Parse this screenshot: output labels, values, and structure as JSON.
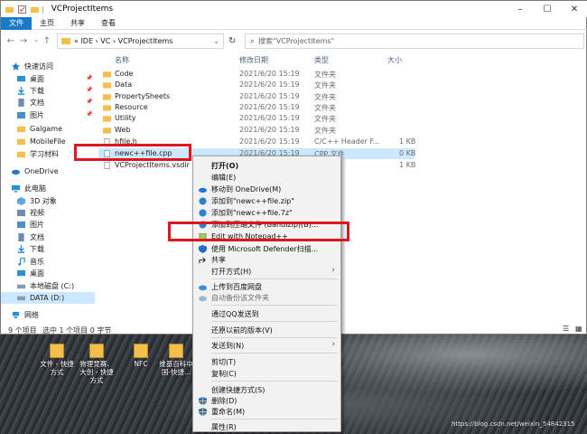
{
  "window": {
    "title": "VCProjectItems",
    "minimize": "–",
    "maximize": "☐",
    "close": "✕"
  },
  "ribbon": {
    "tabs": [
      "文件",
      "主页",
      "共享",
      "查看"
    ]
  },
  "address": {
    "crumbs": "«  IDE  ›  VC  ›  VCProjectItems",
    "search_placeholder": "搜索\"VCProjectItems\""
  },
  "nav": {
    "items": [
      {
        "label": "快速访问",
        "icon": "star-icon",
        "color": "#1c7ad1"
      },
      {
        "label": "桌面",
        "icon": "desktop-icon",
        "color": "#2d8fd6"
      },
      {
        "label": "下载",
        "icon": "download-icon",
        "color": "#2d8fd6"
      },
      {
        "label": "文档",
        "icon": "document-icon",
        "color": "#6f8bb0"
      },
      {
        "label": "图片",
        "icon": "picture-icon",
        "color": "#4a90c8"
      },
      {
        "label": "Galgame",
        "icon": "folder-icon",
        "color": "#f4c04d"
      },
      {
        "label": "MobileFile",
        "icon": "folder-icon",
        "color": "#f4c04d"
      },
      {
        "label": "学习材料",
        "icon": "folder-icon",
        "color": "#f4c04d"
      },
      {
        "label": "OneDrive",
        "icon": "cloud-icon",
        "color": "#1c7ad1"
      },
      {
        "label": "此电脑",
        "icon": "computer-icon",
        "color": "#2d8fd6"
      },
      {
        "label": "3D 对象",
        "icon": "cube-icon",
        "color": "#5aa6e0"
      },
      {
        "label": "视频",
        "icon": "video-icon",
        "color": "#6f8bb0"
      },
      {
        "label": "图片",
        "icon": "picture-icon",
        "color": "#4a90c8"
      },
      {
        "label": "文档",
        "icon": "document-icon",
        "color": "#6f8bb0"
      },
      {
        "label": "下载",
        "icon": "download-icon",
        "color": "#2d8fd6"
      },
      {
        "label": "音乐",
        "icon": "music-icon",
        "color": "#2d8fd6"
      },
      {
        "label": "桌面",
        "icon": "desktop-icon",
        "color": "#2d8fd6"
      },
      {
        "label": "本地磁盘 (C:)",
        "icon": "drive-icon",
        "color": "#8a9bb0"
      },
      {
        "label": "DATA (D:)",
        "icon": "drive-icon",
        "color": "#8a9bb0"
      },
      {
        "label": "网络",
        "icon": "network-icon",
        "color": "#2d8fd6"
      }
    ]
  },
  "columns": {
    "name": "名称",
    "date": "修改日期",
    "type": "类型",
    "size": "大小"
  },
  "files": [
    {
      "name": "Code",
      "date": "2021/6/20 15:19",
      "type": "文件夹",
      "size": "",
      "icon": "folder-icon"
    },
    {
      "name": "Data",
      "date": "2021/6/20 15:19",
      "type": "文件夹",
      "size": "",
      "icon": "folder-icon"
    },
    {
      "name": "PropertySheets",
      "date": "2021/6/20 15:19",
      "type": "文件夹",
      "size": "",
      "icon": "folder-icon"
    },
    {
      "name": "Resource",
      "date": "2021/6/20 15:19",
      "type": "文件夹",
      "size": "",
      "icon": "folder-icon"
    },
    {
      "name": "Utility",
      "date": "2021/6/20 15:19",
      "type": "文件夹",
      "size": "",
      "icon": "folder-icon"
    },
    {
      "name": "Web",
      "date": "2021/6/20 15:19",
      "type": "文件夹",
      "size": "",
      "icon": "folder-icon"
    },
    {
      "name": "hfile.h",
      "date": "2021/6/20 15:19",
      "type": "C/C++ Header F...",
      "size": "1 KB",
      "icon": "header-file-icon"
    },
    {
      "name": "newc++file.cpp",
      "date": "2021/6/20 15:19",
      "type": "CPP 文件",
      "size": "0 KB",
      "icon": "cpp-file-icon"
    },
    {
      "name": "VCProjectItems.vsdir",
      "date": "",
      "type": "",
      "size": "1 KB",
      "icon": "vsdir-file-icon"
    }
  ],
  "status": {
    "count": "9 个项目",
    "selected": "选中 1 个项目 0 字节"
  },
  "desktop_icons": [
    {
      "label": "文件 - 快捷方式"
    },
    {
      "label": "物理竞赛、大创 - 快捷方式"
    },
    {
      "label": "NFC"
    },
    {
      "label": "维基百科中国-快捷..."
    }
  ],
  "context_menu": {
    "items": [
      {
        "label": "打开(O)",
        "bold": true,
        "icon": "",
        "disabled": false,
        "arrow": false
      },
      {
        "label": "编辑(E)",
        "icon": "",
        "disabled": false,
        "arrow": false
      },
      {
        "label": "移动到 OneDrive(M)",
        "icon": "onedrive-icon",
        "disabled": false,
        "arrow": false
      },
      {
        "label": "添加到\"newc++file.zip\"",
        "icon": "archive-icon",
        "disabled": false,
        "arrow": false
      },
      {
        "label": "添加到\"newc++file.7z\"",
        "icon": "archive-icon",
        "disabled": false,
        "arrow": false
      },
      {
        "label": "添加到压缩文件 (Bandizip)(B)...",
        "icon": "archive-icon",
        "disabled": false,
        "arrow": false
      },
      {
        "label": "Edit with Notepad++",
        "icon": "notepad-icon",
        "disabled": false,
        "arrow": false
      },
      {
        "label": "使用 Microsoft Defender扫描...",
        "icon": "defender-icon",
        "disabled": false,
        "arrow": false
      },
      {
        "label": "共享",
        "icon": "share-icon",
        "disabled": false,
        "arrow": false
      },
      {
        "label": "打开方式(H)",
        "icon": "",
        "disabled": false,
        "arrow": true
      },
      {
        "label": "上传到百度网盘",
        "icon": "baidu-cloud-icon",
        "disabled": false,
        "arrow": false
      },
      {
        "label": "自动备份该文件夹",
        "icon": "baidu-cloud-icon",
        "disabled": true,
        "arrow": false
      },
      {
        "label": "通过QQ发送到",
        "icon": "",
        "disabled": false,
        "arrow": false
      },
      {
        "label": "还原以前的版本(V)",
        "icon": "",
        "disabled": false,
        "arrow": false
      },
      {
        "label": "发送到(N)",
        "icon": "",
        "disabled": false,
        "arrow": true
      },
      {
        "label": "剪切(T)",
        "icon": "",
        "disabled": false,
        "arrow": false
      },
      {
        "label": "复制(C)",
        "icon": "",
        "disabled": false,
        "arrow": false
      },
      {
        "label": "创建快捷方式(S)",
        "icon": "",
        "disabled": false,
        "arrow": false
      },
      {
        "label": "删除(D)",
        "icon": "shield-icon",
        "disabled": false,
        "arrow": false
      },
      {
        "label": "重命名(M)",
        "icon": "shield-icon",
        "disabled": false,
        "arrow": false
      },
      {
        "label": "属性(R)",
        "icon": "",
        "disabled": false,
        "arrow": false
      }
    ]
  },
  "watermark": "https://blog.csdn.net/weixin_54842315",
  "colors": {
    "accent": "#1979ca",
    "highlight_red": "#e0161e",
    "selection": "#cce8ff"
  }
}
